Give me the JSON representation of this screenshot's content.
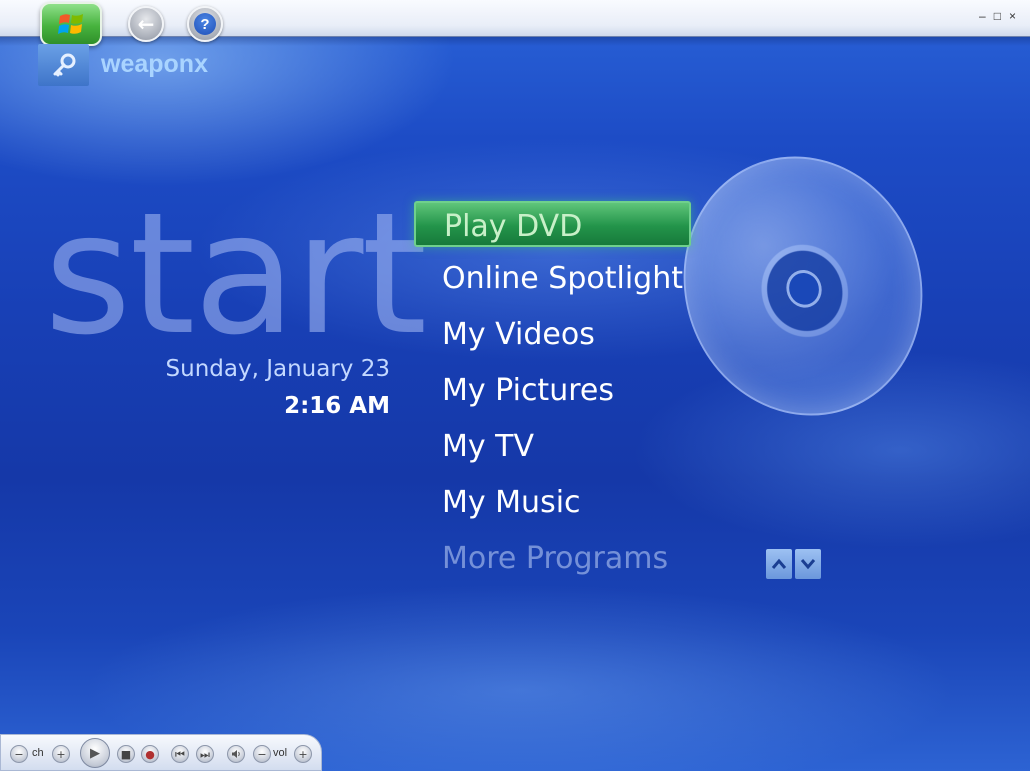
{
  "window": {
    "controls": {
      "minimize": "–",
      "maximize": "□",
      "close": "×"
    }
  },
  "toolbar": {
    "start_button_icon": "windows-logo-icon",
    "back_button_icon": "back-arrow-icon",
    "help_button_icon": "help-icon",
    "help_glyph": "?",
    "back_glyph": "←"
  },
  "user": {
    "name": "weaponx",
    "icon": "key-icon"
  },
  "page": {
    "title": "start",
    "date": "Sunday, January 23",
    "time": "2:16 AM"
  },
  "menu": {
    "items": [
      {
        "label": "Play DVD",
        "state": "selected"
      },
      {
        "label": "Online Spotlight",
        "state": "normal"
      },
      {
        "label": "My Videos",
        "state": "normal"
      },
      {
        "label": "My Pictures",
        "state": "normal"
      },
      {
        "label": "My TV",
        "state": "normal"
      },
      {
        "label": "My Music",
        "state": "normal"
      },
      {
        "label": "More Programs",
        "state": "faded"
      }
    ],
    "scroll_up_glyph": "⌃",
    "scroll_down_glyph": "⌄"
  },
  "transport": {
    "ch_label": "ch",
    "vol_label": "vol",
    "minus": "−",
    "plus": "+",
    "play": "▶",
    "stop": "■",
    "record": "●",
    "prev": "⏮",
    "next": "⏭",
    "mute": "🔈"
  },
  "colors": {
    "background": "#1840b6",
    "selection": "#23944a",
    "username": "#a9d4ff",
    "date": "#c3d8ff"
  }
}
